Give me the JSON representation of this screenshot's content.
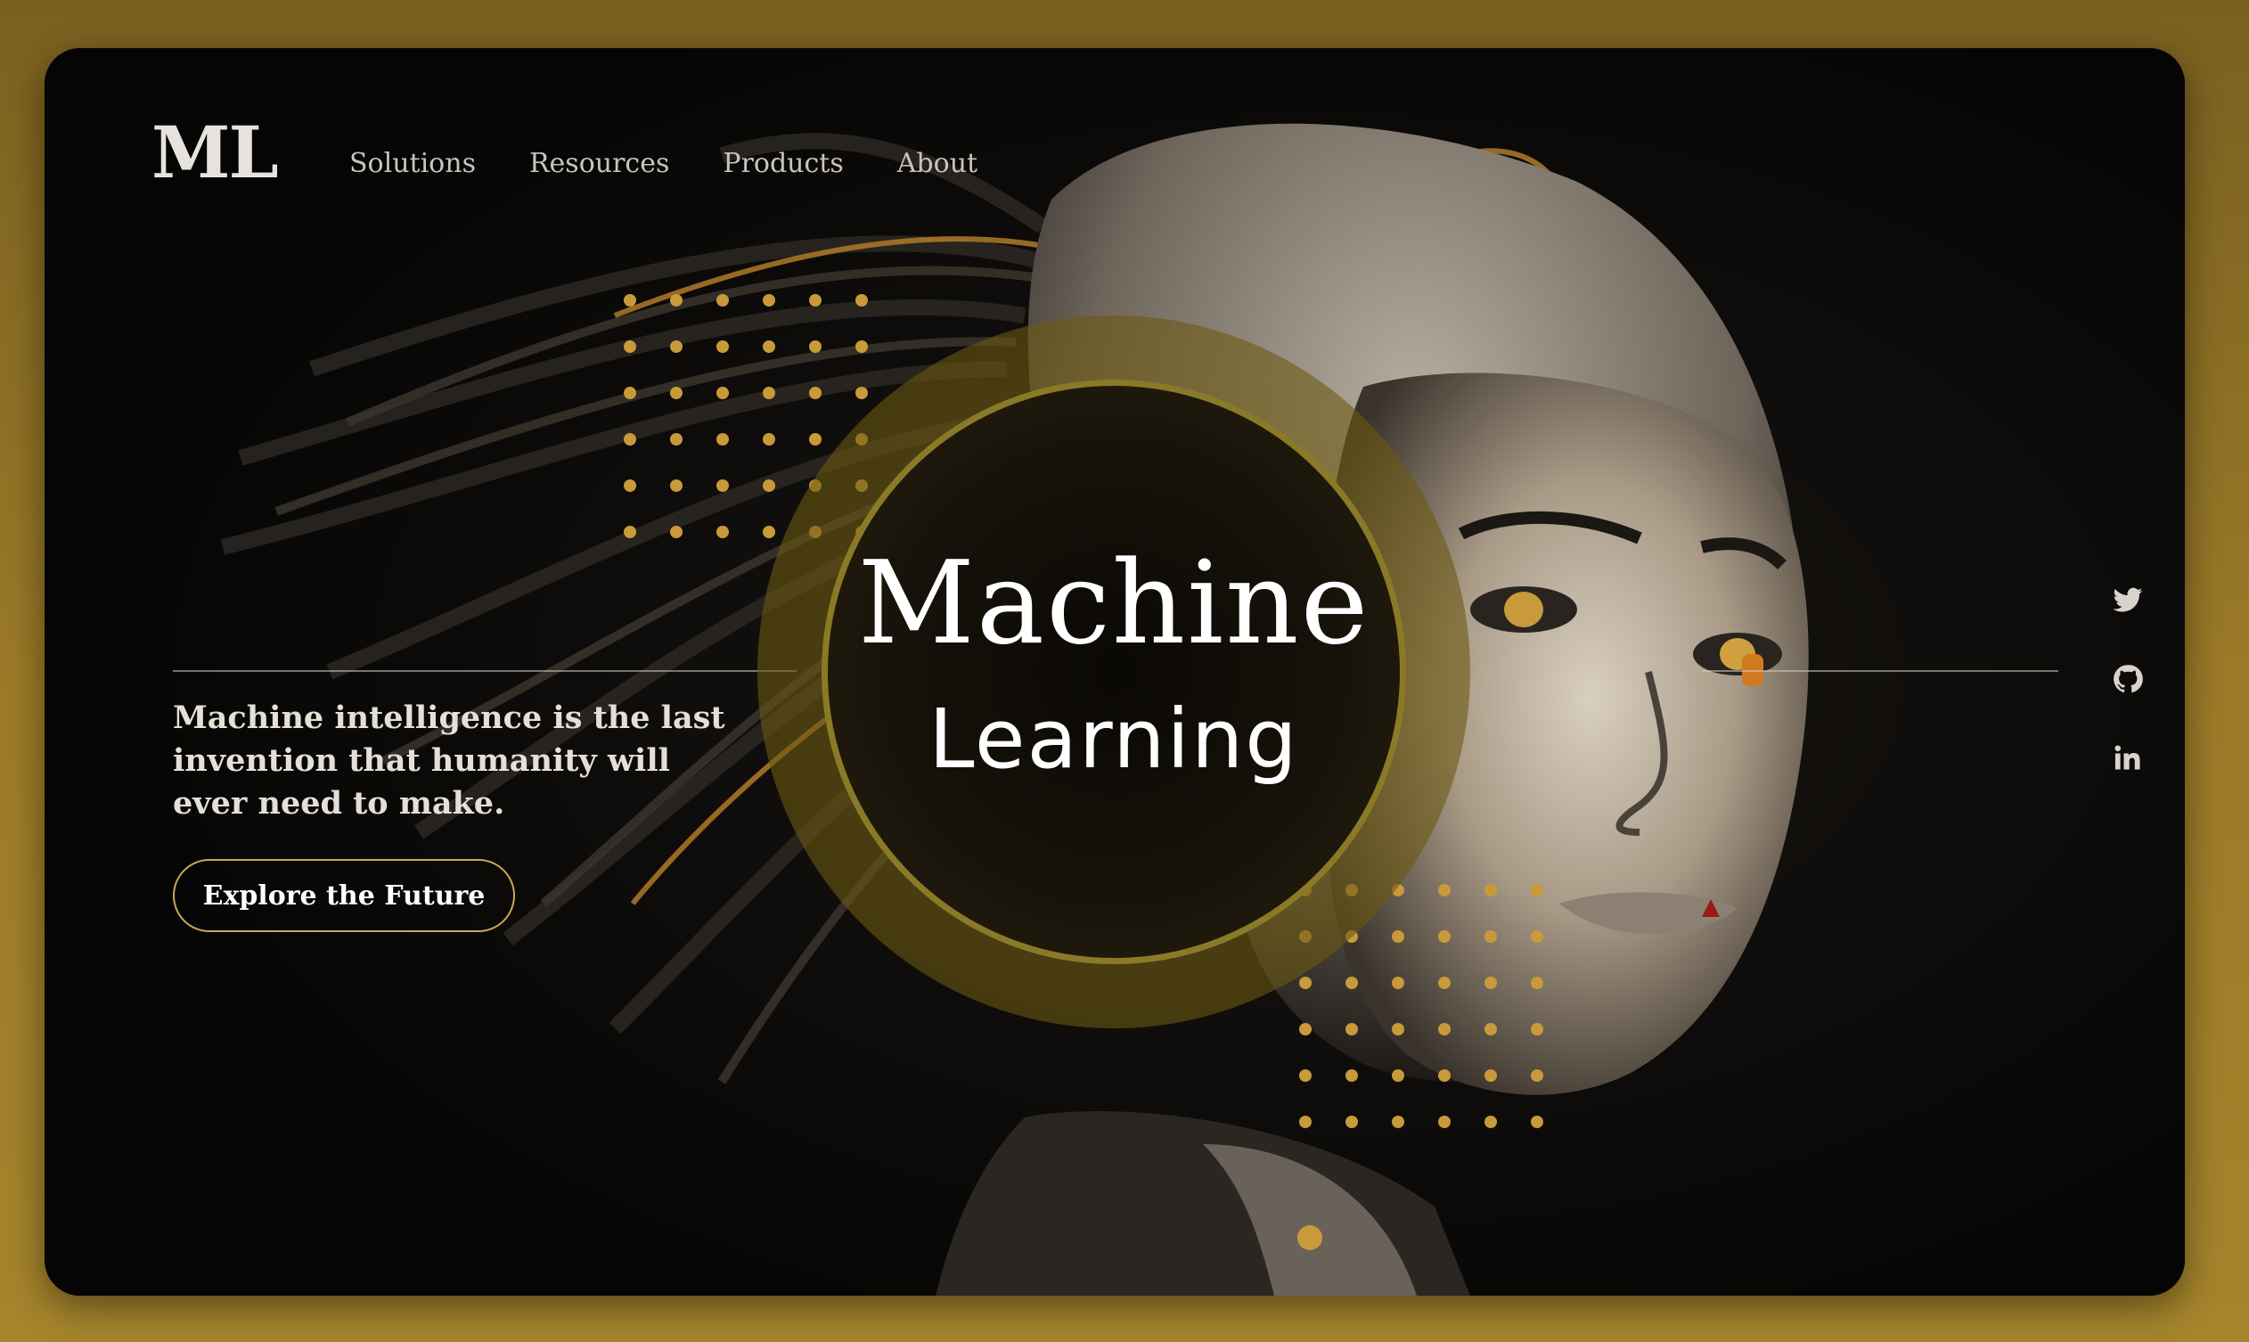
{
  "brand": {
    "logo": "ML"
  },
  "nav": {
    "items": [
      {
        "label": "Solutions"
      },
      {
        "label": "Resources"
      },
      {
        "label": "Products"
      },
      {
        "label": "About"
      }
    ]
  },
  "hero": {
    "title_line1": "Machine",
    "title_line2": "Learning",
    "tagline": "Machine intelligence is the last invention that humanity will ever need to make.",
    "cta_label": "Explore the Future"
  },
  "social": {
    "icons": [
      "twitter-icon",
      "github-icon",
      "linkedin-icon"
    ]
  },
  "colors": {
    "background": "#a5842c",
    "card": "#050505",
    "accent_gold": "#c89a3a",
    "ring": "#8a7a28",
    "text_light": "#e4dfd7"
  }
}
